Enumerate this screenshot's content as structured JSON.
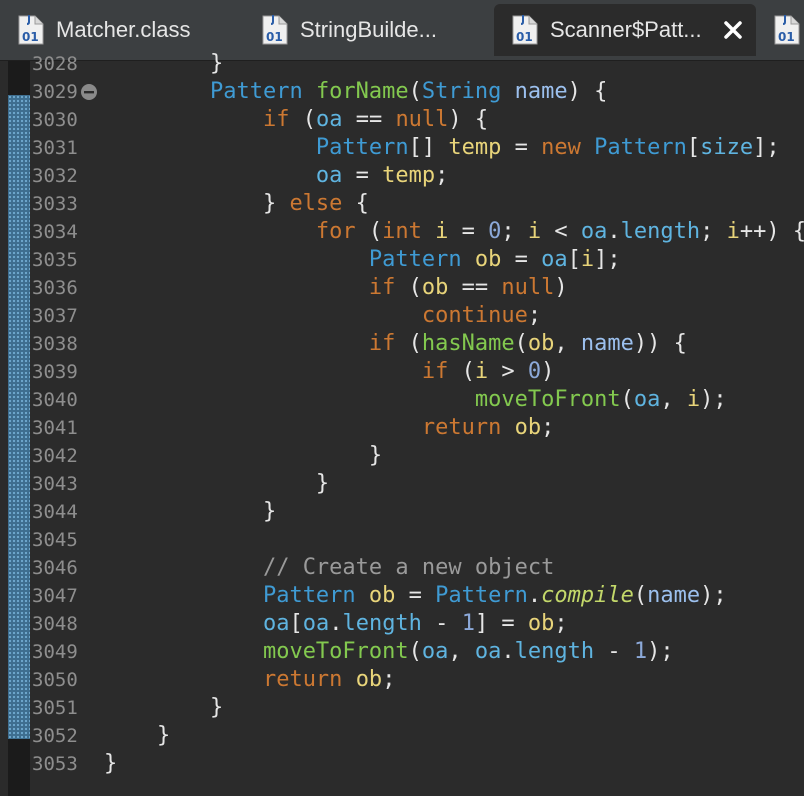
{
  "tabs": [
    {
      "label": "Matcher.class",
      "icon": "class-file-icon",
      "active": false
    },
    {
      "label": "StringBuilde...",
      "icon": "class-file-icon",
      "active": false
    },
    {
      "label": "Scanner$Patt...",
      "icon": "class-file-icon",
      "active": true,
      "closable": true
    },
    {
      "label": "",
      "icon": "class-file-icon",
      "active": false
    }
  ],
  "icon_badge": "01",
  "colors": {
    "keyword": "#cc7832",
    "type": "#3f9bd4",
    "method": "#83c94f",
    "local_var": "#e8d47a",
    "field": "#5fb4e0",
    "param": "#9cc0ee",
    "number": "#8ca9d9",
    "comment": "#9a9a9a",
    "static_method": "#c3d86a",
    "editor_bg": "#2b2b2b",
    "line_number": "#8e8e8e",
    "change_mark": "#3e6e8f"
  },
  "editor": {
    "lines": [
      {
        "num": "3028",
        "tokens": [
          [
            "plain",
            "        }"
          ]
        ]
      },
      {
        "num": "3029",
        "fold": true,
        "tokens": [
          [
            "plain",
            "        "
          ],
          [
            "type",
            "Pattern"
          ],
          [
            "plain",
            " "
          ],
          [
            "method",
            "forName"
          ],
          [
            "plain",
            "("
          ],
          [
            "type",
            "String"
          ],
          [
            "plain",
            " "
          ],
          [
            "param",
            "name"
          ],
          [
            "plain",
            ") {"
          ]
        ]
      },
      {
        "num": "3030",
        "tokens": [
          [
            "plain",
            "            "
          ],
          [
            "kw",
            "if"
          ],
          [
            "plain",
            " ("
          ],
          [
            "field",
            "oa"
          ],
          [
            "plain",
            " == "
          ],
          [
            "kw",
            "null"
          ],
          [
            "plain",
            ") {"
          ]
        ]
      },
      {
        "num": "3031",
        "tokens": [
          [
            "plain",
            "                "
          ],
          [
            "type",
            "Pattern"
          ],
          [
            "plain",
            "[] "
          ],
          [
            "var",
            "temp"
          ],
          [
            "plain",
            " = "
          ],
          [
            "kw",
            "new"
          ],
          [
            "plain",
            " "
          ],
          [
            "type",
            "Pattern"
          ],
          [
            "plain",
            "["
          ],
          [
            "field",
            "size"
          ],
          [
            "plain",
            "];"
          ]
        ]
      },
      {
        "num": "3032",
        "tokens": [
          [
            "plain",
            "                "
          ],
          [
            "field",
            "oa"
          ],
          [
            "plain",
            " = "
          ],
          [
            "var",
            "temp"
          ],
          [
            "plain",
            ";"
          ]
        ]
      },
      {
        "num": "3033",
        "tokens": [
          [
            "plain",
            "            } "
          ],
          [
            "kw",
            "else"
          ],
          [
            "plain",
            " {"
          ]
        ]
      },
      {
        "num": "3034",
        "tokens": [
          [
            "plain",
            "                "
          ],
          [
            "kw",
            "for"
          ],
          [
            "plain",
            " ("
          ],
          [
            "kw",
            "int"
          ],
          [
            "plain",
            " "
          ],
          [
            "var",
            "i"
          ],
          [
            "plain",
            " = "
          ],
          [
            "num",
            "0"
          ],
          [
            "plain",
            "; "
          ],
          [
            "var",
            "i"
          ],
          [
            "plain",
            " < "
          ],
          [
            "field",
            "oa"
          ],
          [
            "plain",
            "."
          ],
          [
            "field",
            "length"
          ],
          [
            "plain",
            "; "
          ],
          [
            "var",
            "i"
          ],
          [
            "plain",
            "++) {"
          ]
        ]
      },
      {
        "num": "3035",
        "tokens": [
          [
            "plain",
            "                    "
          ],
          [
            "type",
            "Pattern"
          ],
          [
            "plain",
            " "
          ],
          [
            "var",
            "ob"
          ],
          [
            "plain",
            " = "
          ],
          [
            "field",
            "oa"
          ],
          [
            "plain",
            "["
          ],
          [
            "var",
            "i"
          ],
          [
            "plain",
            "];"
          ]
        ]
      },
      {
        "num": "3036",
        "tokens": [
          [
            "plain",
            "                    "
          ],
          [
            "kw",
            "if"
          ],
          [
            "plain",
            " ("
          ],
          [
            "var",
            "ob"
          ],
          [
            "plain",
            " == "
          ],
          [
            "kw",
            "null"
          ],
          [
            "plain",
            ")"
          ]
        ]
      },
      {
        "num": "3037",
        "tokens": [
          [
            "plain",
            "                        "
          ],
          [
            "kw",
            "continue"
          ],
          [
            "plain",
            ";"
          ]
        ]
      },
      {
        "num": "3038",
        "tokens": [
          [
            "plain",
            "                    "
          ],
          [
            "kw",
            "if"
          ],
          [
            "plain",
            " ("
          ],
          [
            "method",
            "hasName"
          ],
          [
            "plain",
            "("
          ],
          [
            "var",
            "ob"
          ],
          [
            "plain",
            ", "
          ],
          [
            "param",
            "name"
          ],
          [
            "plain",
            ")) {"
          ]
        ]
      },
      {
        "num": "3039",
        "tokens": [
          [
            "plain",
            "                        "
          ],
          [
            "kw",
            "if"
          ],
          [
            "plain",
            " ("
          ],
          [
            "var",
            "i"
          ],
          [
            "plain",
            " > "
          ],
          [
            "num",
            "0"
          ],
          [
            "plain",
            ")"
          ]
        ]
      },
      {
        "num": "3040",
        "tokens": [
          [
            "plain",
            "                            "
          ],
          [
            "method",
            "moveToFront"
          ],
          [
            "plain",
            "("
          ],
          [
            "field",
            "oa"
          ],
          [
            "plain",
            ", "
          ],
          [
            "var",
            "i"
          ],
          [
            "plain",
            ");"
          ]
        ]
      },
      {
        "num": "3041",
        "tokens": [
          [
            "plain",
            "                        "
          ],
          [
            "kw",
            "return"
          ],
          [
            "plain",
            " "
          ],
          [
            "var",
            "ob"
          ],
          [
            "plain",
            ";"
          ]
        ]
      },
      {
        "num": "3042",
        "tokens": [
          [
            "plain",
            "                    }"
          ]
        ]
      },
      {
        "num": "3043",
        "tokens": [
          [
            "plain",
            "                }"
          ]
        ]
      },
      {
        "num": "3044",
        "tokens": [
          [
            "plain",
            "            }"
          ]
        ]
      },
      {
        "num": "3045",
        "tokens": []
      },
      {
        "num": "3046",
        "tokens": [
          [
            "plain",
            "            "
          ],
          [
            "comment",
            "// Create a new object"
          ]
        ]
      },
      {
        "num": "3047",
        "tokens": [
          [
            "plain",
            "            "
          ],
          [
            "type",
            "Pattern"
          ],
          [
            "plain",
            " "
          ],
          [
            "var",
            "ob"
          ],
          [
            "plain",
            " = "
          ],
          [
            "type",
            "Pattern"
          ],
          [
            "plain",
            "."
          ],
          [
            "static",
            "compile"
          ],
          [
            "plain",
            "("
          ],
          [
            "param",
            "name"
          ],
          [
            "plain",
            ");"
          ]
        ]
      },
      {
        "num": "3048",
        "tokens": [
          [
            "plain",
            "            "
          ],
          [
            "field",
            "oa"
          ],
          [
            "plain",
            "["
          ],
          [
            "field",
            "oa"
          ],
          [
            "plain",
            "."
          ],
          [
            "field",
            "length"
          ],
          [
            "plain",
            " - "
          ],
          [
            "num",
            "1"
          ],
          [
            "plain",
            "] = "
          ],
          [
            "var",
            "ob"
          ],
          [
            "plain",
            ";"
          ]
        ]
      },
      {
        "num": "3049",
        "tokens": [
          [
            "plain",
            "            "
          ],
          [
            "method",
            "moveToFront"
          ],
          [
            "plain",
            "("
          ],
          [
            "field",
            "oa"
          ],
          [
            "plain",
            ", "
          ],
          [
            "field",
            "oa"
          ],
          [
            "plain",
            "."
          ],
          [
            "field",
            "length"
          ],
          [
            "plain",
            " - "
          ],
          [
            "num",
            "1"
          ],
          [
            "plain",
            ");"
          ]
        ]
      },
      {
        "num": "3050",
        "tokens": [
          [
            "plain",
            "            "
          ],
          [
            "kw",
            "return"
          ],
          [
            "plain",
            " "
          ],
          [
            "var",
            "ob"
          ],
          [
            "plain",
            ";"
          ]
        ]
      },
      {
        "num": "3051",
        "tokens": [
          [
            "plain",
            "        }"
          ]
        ]
      },
      {
        "num": "3052",
        "tokens": [
          [
            "plain",
            "    }"
          ]
        ]
      },
      {
        "num": "3053",
        "tokens": [
          [
            "plain",
            "}"
          ]
        ]
      }
    ]
  }
}
